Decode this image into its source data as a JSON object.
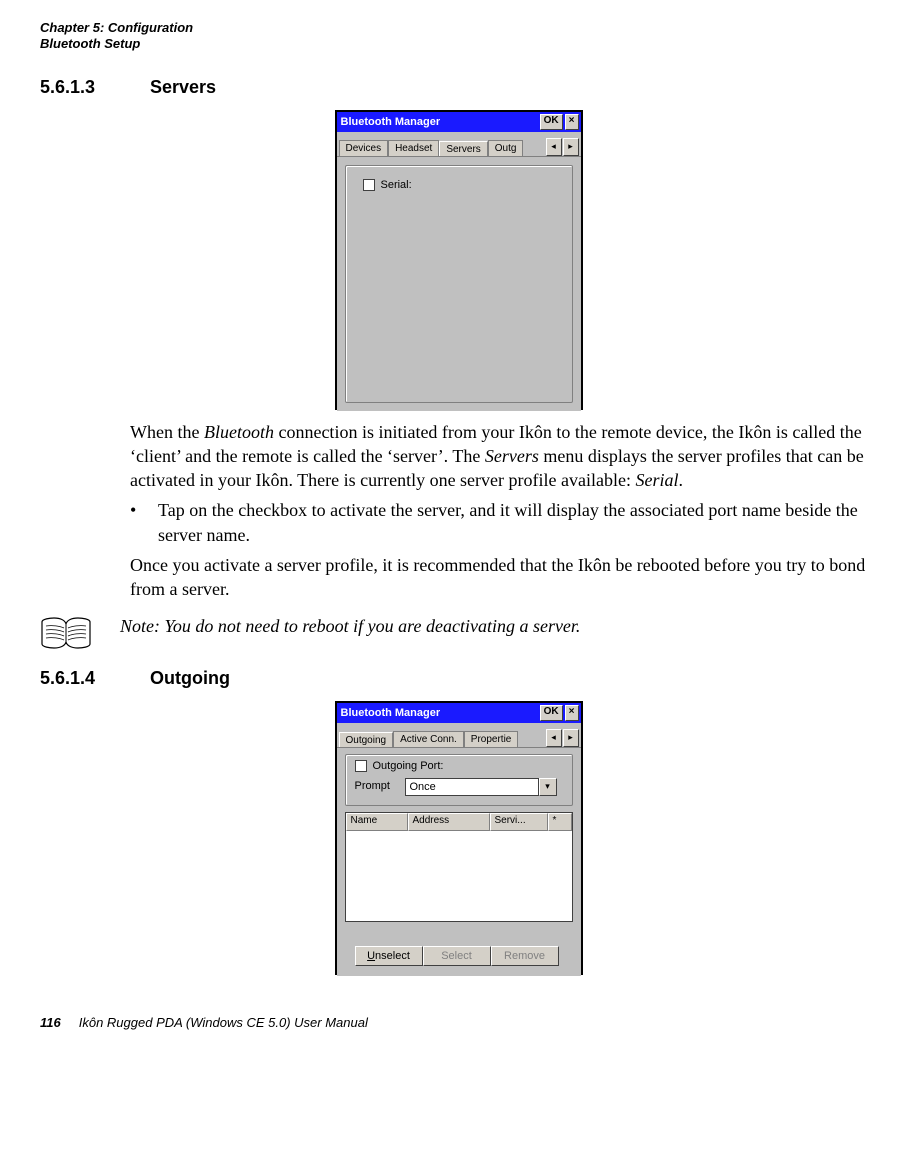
{
  "header": {
    "line1": "Chapter 5:  Configuration",
    "line2": "Bluetooth Setup"
  },
  "sections": {
    "servers": {
      "num": "5.6.1.3",
      "title": "Servers"
    },
    "outgoing": {
      "num": "5.6.1.4",
      "title": "Outgoing"
    }
  },
  "screenshot1": {
    "title": "Bluetooth Manager",
    "ok": "OK",
    "close": "×",
    "tabs": {
      "devices": "Devices",
      "headset": "Headset",
      "servers": "Servers",
      "outgoing": "Outg"
    },
    "arrows": {
      "left": "◂",
      "right": "▸"
    },
    "serial_label": "Serial:"
  },
  "screenshot2": {
    "title": "Bluetooth Manager",
    "ok": "OK",
    "close": "×",
    "tabs": {
      "outgoing": "Outgoing",
      "active": "Active Conn.",
      "properties": "Propertie"
    },
    "arrows": {
      "left": "◂",
      "right": "▸"
    },
    "outgoing_port_label": "Outgoing Port:",
    "prompt_label": "Prompt",
    "prompt_value": "Once",
    "grid": {
      "name": "Name",
      "address": "Address",
      "servi": "Servi...",
      "star": "*"
    },
    "buttons": {
      "unselect_u": "U",
      "unselect_rest": "nselect",
      "select": "Select",
      "remove": "Remove"
    }
  },
  "paragraphs": {
    "p1a": "When the ",
    "p1b": "Bluetooth",
    "p1c": " connection is initiated from your Ikôn to the remote device, the Ikôn is called the ‘client’ and the remote is called the ‘server’. The ",
    "p1d": "Servers",
    "p1e": " menu displays the server profiles that can be activated in your Ikôn. There is currently one server profile available: ",
    "p1f": "Serial",
    "p1g": ".",
    "bullet1": "Tap on the checkbox to activate the server, and it will display the associated port name beside the server name.",
    "p2": "Once you activate a server profile, it is recommended that the Ikôn be rebooted before you try to bond from a server.",
    "note": "Note: You do not need to reboot if you are deactivating a server."
  },
  "footer": {
    "page": "116",
    "title": "Ikôn Rugged PDA (Windows CE 5.0) User Manual"
  },
  "bullet_char": "•"
}
